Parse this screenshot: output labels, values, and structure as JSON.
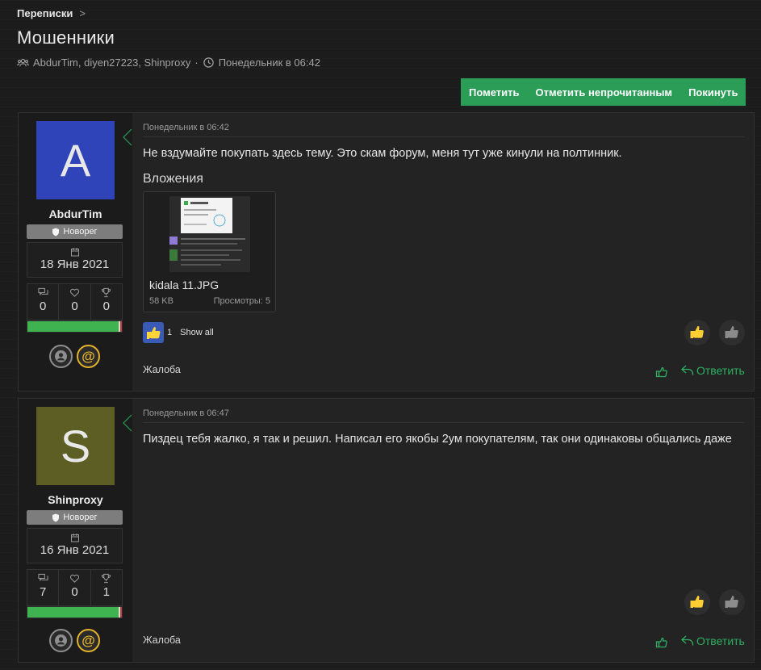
{
  "breadcrumb": {
    "label": "Переписки",
    "chevron": ">"
  },
  "thread": {
    "title": "Мошенники",
    "participants": "AbdurTim, diyen27223, Shinproxy",
    "separator": "·",
    "started": "Понедельник в 06:42"
  },
  "actions": [
    {
      "label": "Пометить"
    },
    {
      "label": "Отметить непрочитанным"
    },
    {
      "label": "Покинуть"
    }
  ],
  "colors": {
    "accent": "#2b9d57",
    "link": "#2dae61",
    "mention": "#e3b32a"
  },
  "posts": [
    {
      "avatar_letter": "A",
      "avatar_color": "#2f44b8",
      "username": "AbdurTim",
      "badge": "Новорег",
      "join_date": "18 Янв 2021",
      "stats": {
        "messages": "0",
        "likes": "0",
        "trophies": "0"
      },
      "date": "Понедельник в 06:42",
      "text": "Не вздумайте покупать здесь тему. Это скам форум, меня тут уже кинули на полтинник.",
      "attachments_title": "Вложения",
      "attachment": {
        "filename": "kidala 11.JPG",
        "size": "58 KB",
        "views": "Просмотры: 5"
      },
      "reactions": {
        "count": "1",
        "show_all": "Show all"
      },
      "report": "Жалоба",
      "reply": "Ответить"
    },
    {
      "avatar_letter": "S",
      "avatar_color": "#5c5e24",
      "username": "Shinproxy",
      "badge": "Новорег",
      "join_date": "16 Янв 2021",
      "stats": {
        "messages": "7",
        "likes": "0",
        "trophies": "1"
      },
      "date": "Понедельник в 06:47",
      "text": "Пиздец тебя жалко, я так и решил. Написал его якобы 2ум покупателям, так они одинаковы общались даже",
      "report": "Жалоба",
      "reply": "Ответить"
    }
  ]
}
